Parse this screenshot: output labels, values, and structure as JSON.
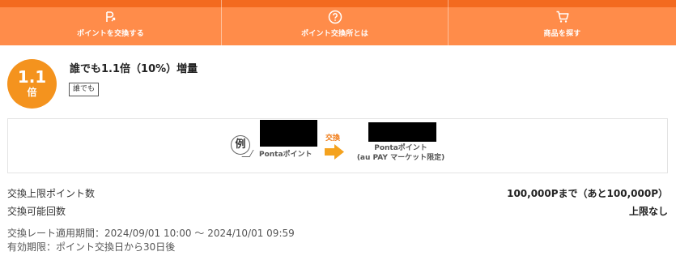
{
  "nav": {
    "items": [
      {
        "label": "ポイントを交換する",
        "icon": "point-exchange-icon"
      },
      {
        "label": "ポイント交換所とは",
        "icon": "question-circle-icon"
      },
      {
        "label": "商品を探す",
        "icon": "cart-icon"
      }
    ],
    "colors": {
      "bar": "#ff8c4a",
      "strip": "#f36a1f"
    }
  },
  "offer": {
    "rate_value": "1.1",
    "rate_unit": "倍",
    "title": "誰でも1.1倍（10%）増量",
    "tag": "誰でも",
    "accent_color": "#f4931e"
  },
  "example": {
    "mark": "例",
    "source_label": "Pontaポイント",
    "exchange_label": "交換",
    "destination_line1": "Pontaポイント",
    "destination_line2": "(au PAY マーケット限定)"
  },
  "details": [
    {
      "label": "交換上限ポイント数",
      "value": "100,000Pまで（あと100,000P）"
    },
    {
      "label": "交換可能回数",
      "value": "上限なし"
    }
  ],
  "notes": {
    "period": "交換レート適用期間：2024/09/01 10:00 〜 2024/10/01 09:59",
    "expiry": "有効期限：ポイント交換日から30日後"
  }
}
